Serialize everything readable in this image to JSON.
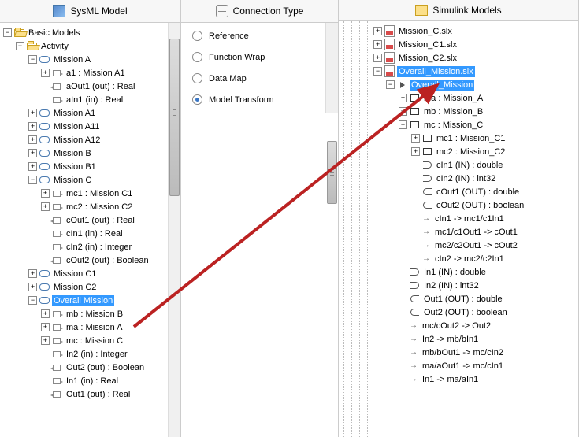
{
  "headers": {
    "sysml": "SysML Model",
    "connection": "Connection Type",
    "simulink": "Simulink Models"
  },
  "connection_options": [
    {
      "label": "Reference",
      "selected": false
    },
    {
      "label": "Function Wrap",
      "selected": false
    },
    {
      "label": "Data Map",
      "selected": false
    },
    {
      "label": "Model Transform",
      "selected": true
    }
  ],
  "sysml_tree": [
    {
      "d": 0,
      "exp": "-",
      "icon": "folder-open",
      "label": "Basic Models"
    },
    {
      "d": 1,
      "exp": "-",
      "icon": "folder-open",
      "label": "Activity"
    },
    {
      "d": 2,
      "exp": "-",
      "icon": "activity",
      "label": "Mission A"
    },
    {
      "d": 3,
      "exp": "+",
      "icon": "pin in",
      "label": "a1 : Mission A1"
    },
    {
      "d": 3,
      "exp": "",
      "icon": "pin out",
      "label": "aOut1 (out) : Real"
    },
    {
      "d": 3,
      "exp": "",
      "icon": "pin in",
      "label": "aIn1 (in) : Real"
    },
    {
      "d": 2,
      "exp": "+",
      "icon": "activity",
      "label": "Mission A1"
    },
    {
      "d": 2,
      "exp": "+",
      "icon": "activity",
      "label": "Mission A11"
    },
    {
      "d": 2,
      "exp": "+",
      "icon": "activity",
      "label": "Mission A12"
    },
    {
      "d": 2,
      "exp": "+",
      "icon": "activity",
      "label": "Mission B"
    },
    {
      "d": 2,
      "exp": "+",
      "icon": "activity",
      "label": "Mission B1"
    },
    {
      "d": 2,
      "exp": "-",
      "icon": "activity",
      "label": "Mission C"
    },
    {
      "d": 3,
      "exp": "+",
      "icon": "pin in",
      "label": "mc1 : Mission C1"
    },
    {
      "d": 3,
      "exp": "+",
      "icon": "pin in",
      "label": "mc2 : Mission C2"
    },
    {
      "d": 3,
      "exp": "",
      "icon": "pin out",
      "label": "cOut1 (out) : Real"
    },
    {
      "d": 3,
      "exp": "",
      "icon": "pin in",
      "label": "cIn1 (in) : Real"
    },
    {
      "d": 3,
      "exp": "",
      "icon": "pin in",
      "label": "cIn2 (in) : Integer"
    },
    {
      "d": 3,
      "exp": "",
      "icon": "pin out",
      "label": "cOut2 (out) : Boolean"
    },
    {
      "d": 2,
      "exp": "+",
      "icon": "activity",
      "label": "Mission C1"
    },
    {
      "d": 2,
      "exp": "+",
      "icon": "activity",
      "label": "Mission C2"
    },
    {
      "d": 2,
      "exp": "-",
      "icon": "activity",
      "label": "Overall Mission",
      "hl": true
    },
    {
      "d": 3,
      "exp": "+",
      "icon": "pin in",
      "label": "mb : Mission B"
    },
    {
      "d": 3,
      "exp": "+",
      "icon": "pin in",
      "label": "ma : Mission A"
    },
    {
      "d": 3,
      "exp": "+",
      "icon": "pin in",
      "label": "mc : Mission C"
    },
    {
      "d": 3,
      "exp": "",
      "icon": "pin in",
      "label": "In2 (in) : Integer"
    },
    {
      "d": 3,
      "exp": "",
      "icon": "pin out",
      "label": "Out2 (out) : Boolean"
    },
    {
      "d": 3,
      "exp": "",
      "icon": "pin in",
      "label": "In1 (in) : Real"
    },
    {
      "d": 3,
      "exp": "",
      "icon": "pin out",
      "label": "Out1 (out) : Real"
    }
  ],
  "simulink_tree": [
    {
      "d": 0,
      "exp": "+",
      "icon": "slx-file",
      "label": "Mission_C.slx"
    },
    {
      "d": 0,
      "exp": "+",
      "icon": "slx-file",
      "label": "Mission_C1.slx"
    },
    {
      "d": 0,
      "exp": "+",
      "icon": "slx-file",
      "label": "Mission_C2.slx"
    },
    {
      "d": 0,
      "exp": "-",
      "icon": "slx-file",
      "label": "Overall_Mission.slx",
      "file_hl": true
    },
    {
      "d": 1,
      "exp": "-",
      "icon": "sl-triangle",
      "label": "Overall_Mission",
      "hl": true
    },
    {
      "d": 2,
      "exp": "+",
      "icon": "sl-block",
      "label": "ma : Mission_A"
    },
    {
      "d": 2,
      "exp": "+",
      "icon": "sl-block",
      "label": "mb : Mission_B"
    },
    {
      "d": 2,
      "exp": "-",
      "icon": "sl-block",
      "label": "mc : Mission_C"
    },
    {
      "d": 3,
      "exp": "+",
      "icon": "sl-block",
      "label": "mc1 : Mission_C1"
    },
    {
      "d": 3,
      "exp": "+",
      "icon": "sl-block",
      "label": "mc2 : Mission_C2"
    },
    {
      "d": 3,
      "exp": "",
      "icon": "sl-port-in",
      "label": "cIn1 (IN) : double"
    },
    {
      "d": 3,
      "exp": "",
      "icon": "sl-port-in",
      "label": "cIn2 (IN) : int32"
    },
    {
      "d": 3,
      "exp": "",
      "icon": "sl-port-out",
      "label": "cOut1 (OUT) : double"
    },
    {
      "d": 3,
      "exp": "",
      "icon": "sl-port-out",
      "label": "cOut2 (OUT) : boolean"
    },
    {
      "d": 3,
      "exp": "",
      "icon": "sl-arrow",
      "label": "cIn1 -> mc1/c1In1"
    },
    {
      "d": 3,
      "exp": "",
      "icon": "sl-arrow",
      "label": "mc1/c1Out1 -> cOut1"
    },
    {
      "d": 3,
      "exp": "",
      "icon": "sl-arrow",
      "label": "mc2/c2Out1 -> cOut2"
    },
    {
      "d": 3,
      "exp": "",
      "icon": "sl-arrow",
      "label": "cIn2 -> mc2/c2In1"
    },
    {
      "d": 2,
      "exp": "",
      "icon": "sl-port-in",
      "label": "In1 (IN) : double"
    },
    {
      "d": 2,
      "exp": "",
      "icon": "sl-port-in",
      "label": "In2 (IN) : int32"
    },
    {
      "d": 2,
      "exp": "",
      "icon": "sl-port-out",
      "label": "Out1 (OUT) : double"
    },
    {
      "d": 2,
      "exp": "",
      "icon": "sl-port-out",
      "label": "Out2 (OUT) : boolean"
    },
    {
      "d": 2,
      "exp": "",
      "icon": "sl-arrow",
      "label": "mc/cOut2 -> Out2"
    },
    {
      "d": 2,
      "exp": "",
      "icon": "sl-arrow",
      "label": "In2 -> mb/bIn1"
    },
    {
      "d": 2,
      "exp": "",
      "icon": "sl-arrow",
      "label": "mb/bOut1 -> mc/cIn2"
    },
    {
      "d": 2,
      "exp": "",
      "icon": "sl-arrow",
      "label": "ma/aOut1 -> mc/cIn1"
    },
    {
      "d": 2,
      "exp": "",
      "icon": "sl-arrow",
      "label": "In1 -> ma/aIn1"
    }
  ]
}
